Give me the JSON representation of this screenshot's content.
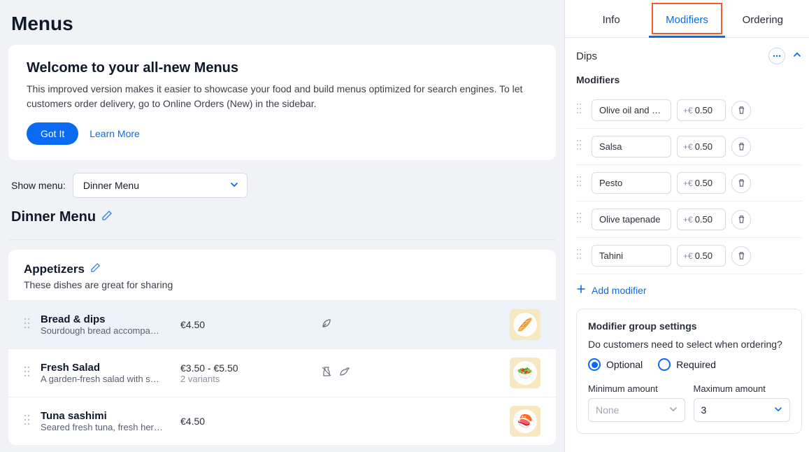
{
  "page": {
    "title": "Menus"
  },
  "welcome": {
    "title": "Welcome to your all-new Menus",
    "desc": "This improved version makes it easier to showcase your food and build menus optimized for search engines.  To let customers order delivery, go to Online Orders (New) in the sidebar.",
    "gotit": "Got It",
    "learnmore": "Learn More"
  },
  "showmenu": {
    "label": "Show menu:",
    "selected": "Dinner Menu"
  },
  "menuheading": "Dinner Menu",
  "section": {
    "title": "Appetizers",
    "desc": "These dishes are great for sharing"
  },
  "dishes": [
    {
      "name": "Bread & dips",
      "desc": "Sourdough bread accompa…",
      "price": "€4.50",
      "variants": "",
      "thumb": "🥖"
    },
    {
      "name": "Fresh Salad",
      "desc": "A garden-fresh salad with s…",
      "price": "€3.50 - €5.50",
      "variants": "2 variants",
      "thumb": "🥗"
    },
    {
      "name": "Tuna sashimi",
      "desc": "Seared fresh tuna, fresh her…",
      "price": "€4.50",
      "variants": "",
      "thumb": "🍣"
    }
  ],
  "panel": {
    "tabs": {
      "info": "Info",
      "modifiers": "Modifiers",
      "ordering": "Ordering"
    },
    "group": "Dips",
    "subheading": "Modifiers",
    "pricePrefix": "+€",
    "mods": [
      {
        "name": "Olive oil and Balsamic",
        "price": "0.50"
      },
      {
        "name": "Salsa",
        "price": "0.50"
      },
      {
        "name": "Pesto",
        "price": "0.50"
      },
      {
        "name": "Olive tapenade",
        "price": "0.50"
      },
      {
        "name": "Tahini",
        "price": "0.50"
      }
    ],
    "addmod": "Add modifier",
    "settings": {
      "title": "Modifier group settings",
      "question": "Do customers need to select when ordering?",
      "optional": "Optional",
      "required": "Required",
      "minlabel": "Minimum amount",
      "maxlabel": "Maximum amount",
      "minval": "None",
      "maxval": "3"
    }
  }
}
